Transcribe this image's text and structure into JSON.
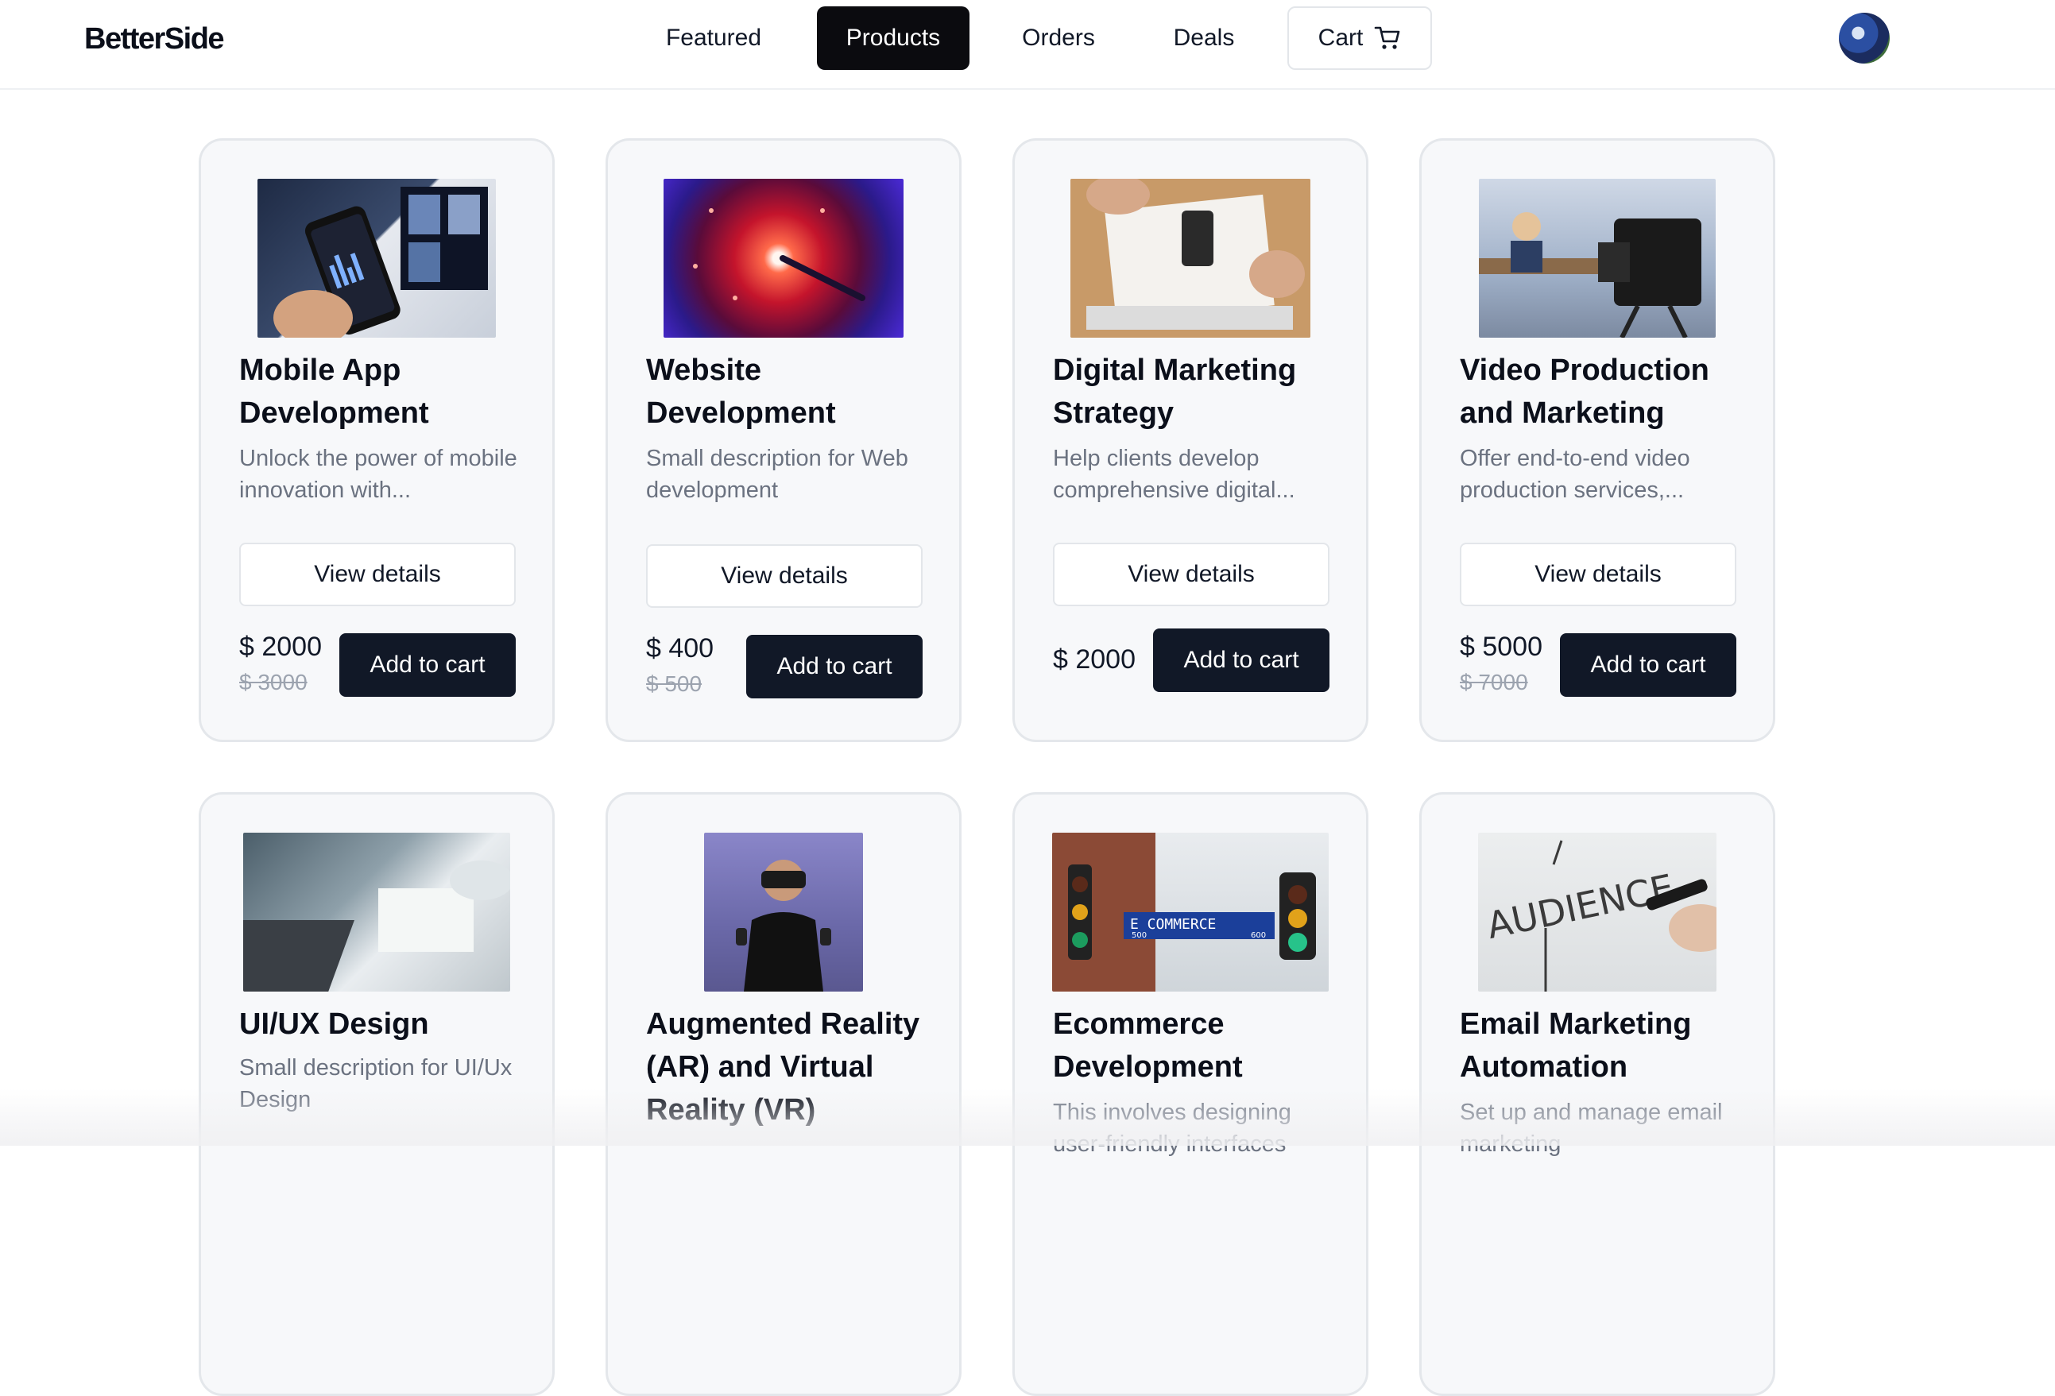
{
  "brand": "BetterSide",
  "nav": {
    "featured": "Featured",
    "products": "Products",
    "orders": "Orders",
    "deals": "Deals",
    "cart": "Cart"
  },
  "products": [
    {
      "title": "Mobile App Development",
      "desc": "Unlock the power of mobile innovation with...",
      "view": "View details",
      "price": "$ 2000",
      "old_price": "$ 3000",
      "cart": "Add to cart"
    },
    {
      "title": "Website Development",
      "desc": "Small description for Web development",
      "view": "View details",
      "price": "$ 400",
      "old_price": "$ 500",
      "cart": "Add to cart"
    },
    {
      "title": "Digital Marketing Strategy",
      "desc": "Help clients develop comprehensive digital...",
      "view": "View details",
      "price": "$ 2000",
      "cart": "Add to cart"
    },
    {
      "title": "Video Production and Marketing",
      "desc": "Offer end-to-end video production services,...",
      "view": "View details",
      "price": "$ 5000",
      "old_price": "$ 7000",
      "cart": "Add to cart"
    },
    {
      "title": "UI/UX Design",
      "desc": "Small description for UI/Ux Design"
    },
    {
      "title": "Augmented Reality (AR) and Virtual Reality (VR)"
    },
    {
      "title": "Ecommerce Development",
      "desc": "This involves designing user-friendly interfaces"
    },
    {
      "title": "Email Marketing Automation",
      "desc": "Set up and manage email marketing"
    }
  ],
  "image_labels": {
    "ecommerce_sign": "E COMMERCE",
    "ecommerce_num_left": "500",
    "ecommerce_num_right": "600",
    "audience_word": "AUDIENCE"
  },
  "icons": {
    "cart": "shopping-cart-icon",
    "avatar": "user-avatar"
  }
}
